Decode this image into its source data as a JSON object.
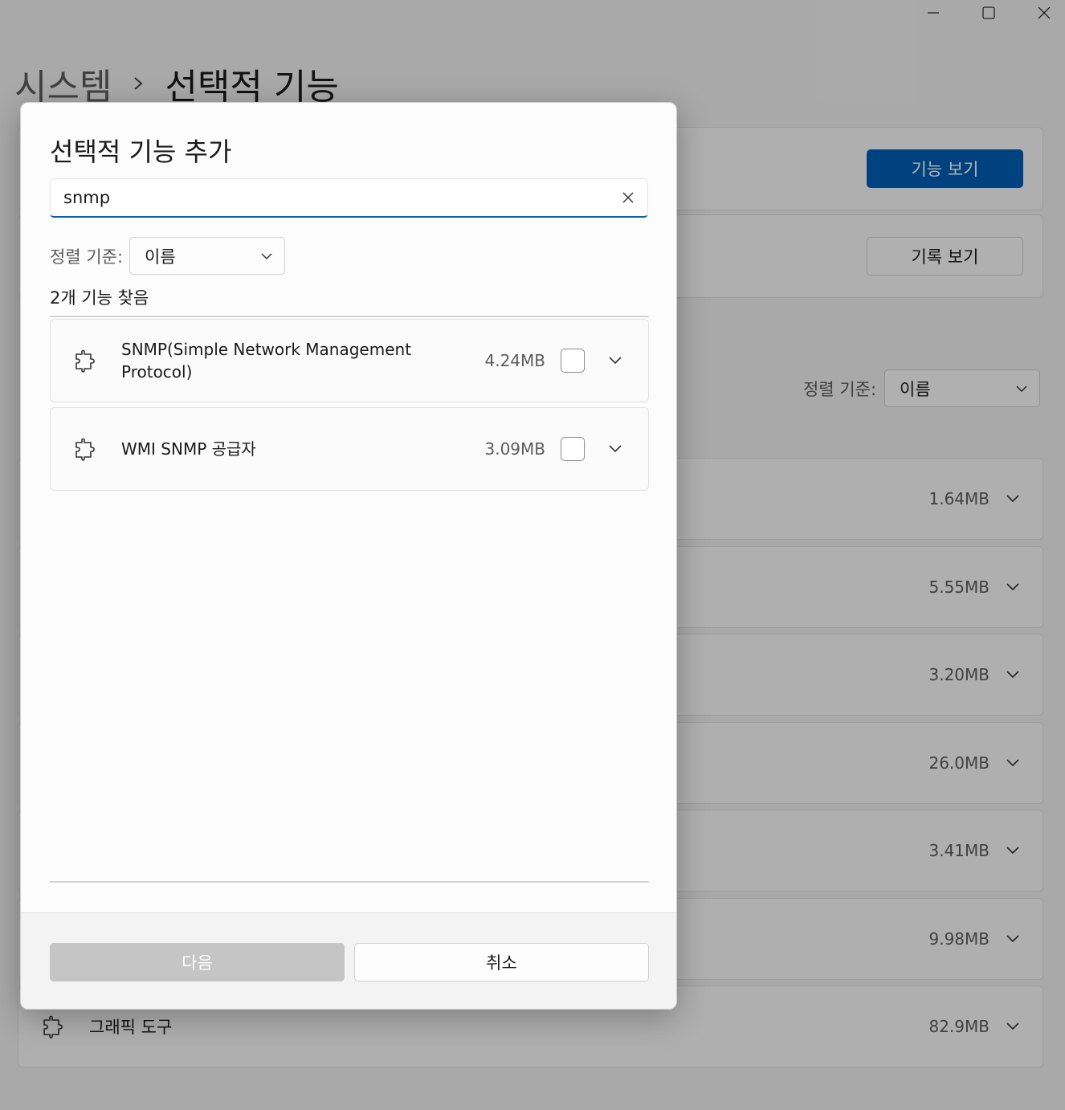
{
  "window": {
    "minimize_icon": "minimize-icon",
    "maximize_icon": "maximize-icon",
    "close_icon": "close-icon"
  },
  "breadcrumb": {
    "parent": "시스템",
    "separator": "›",
    "current": "선택적 기능"
  },
  "background": {
    "view_features_label": "기능 보기",
    "view_history_label": "기록 보기",
    "sort_label": "정렬 기준:",
    "sort_value": "이름",
    "rows": [
      {
        "name": "",
        "size": "1.64MB"
      },
      {
        "name": "",
        "size": "5.55MB"
      },
      {
        "name": "",
        "size": "3.20MB"
      },
      {
        "name": "",
        "size": "26.0MB"
      },
      {
        "name": "",
        "size": "3.41MB"
      },
      {
        "name": "",
        "size": "9.98MB"
      },
      {
        "name": "그래픽 도구",
        "size": "82.9MB"
      }
    ]
  },
  "dialog": {
    "title": "선택적 기능 추가",
    "search": {
      "value": "snmp",
      "clear_icon": "close-icon"
    },
    "sort": {
      "label": "정렬 기준:",
      "value": "이름"
    },
    "result_count": "2개 기능 찾음",
    "features": [
      {
        "name": "SNMP(Simple Network Management Protocol)",
        "size": "4.24MB",
        "checked": false,
        "icon": "puzzle-icon"
      },
      {
        "name": "WMI SNMP 공급자",
        "size": "3.09MB",
        "checked": false,
        "icon": "puzzle-icon"
      }
    ],
    "next_label": "다음",
    "cancel_label": "취소"
  },
  "colors": {
    "accent": "#005fb8",
    "disabled_button": "#c5c5c5"
  }
}
